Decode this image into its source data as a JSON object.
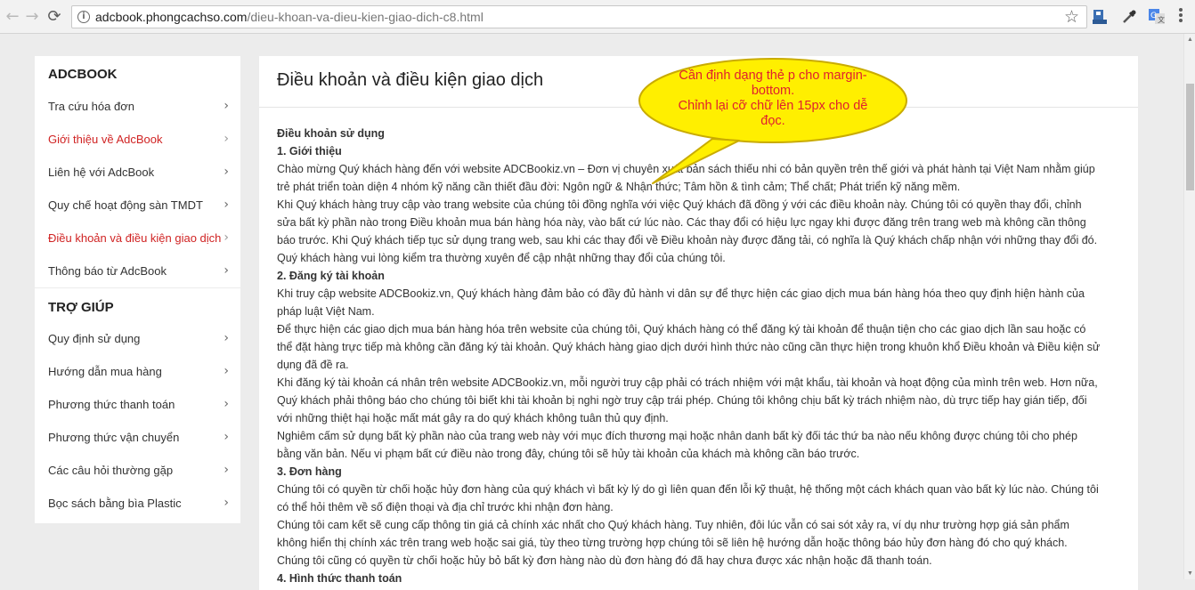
{
  "browser": {
    "back_icon": "←",
    "forward_icon": "→",
    "reload_icon": "⟳",
    "url_domain": "adcbook.phongcachso.com",
    "url_path": "/dieu-khoan-va-dieu-kien-giao-dich-c8.html",
    "star_icon": "☆"
  },
  "sidebar": {
    "section1_title": "ADCBOOK",
    "section1_items": [
      {
        "label": "Tra cứu hóa đơn"
      },
      {
        "label": "Giới thiệu về AdcBook"
      },
      {
        "label": "Liên hệ với AdcBook"
      },
      {
        "label": "Quy chế hoạt động sàn TMDT"
      },
      {
        "label": "Điều khoản và điều kiện giao dịch"
      },
      {
        "label": "Thông báo từ AdcBook"
      }
    ],
    "section2_title": "TRỢ GIÚP",
    "section2_items": [
      {
        "label": "Quy định sử dụng"
      },
      {
        "label": "Hướng dẫn mua hàng"
      },
      {
        "label": "Phương thức thanh toán"
      },
      {
        "label": "Phương thức vận chuyển"
      },
      {
        "label": "Các câu hỏi thường gặp"
      },
      {
        "label": "Bọc sách bằng bìa Plastic"
      }
    ],
    "chevron": "›",
    "highlight_color": "#d02323"
  },
  "main": {
    "title": "Điều khoản và điều kiện giao dịch",
    "lines": [
      {
        "text": "Điều khoản sử dụng",
        "bold": true
      },
      {
        "text": "1. Giới thiệu",
        "bold": true
      },
      {
        "text": "Chào mừng Quý khách hàng đến với website ADCBookiz.vn – Đơn vị chuyên xuất bản sách thiếu nhi có bản quyền trên thế giới và phát hành tại Việt Nam nhằm giúp",
        "bold": false
      },
      {
        "text": "trẻ phát triển toàn diện 4 nhóm kỹ năng cần thiết đầu đời: Ngôn ngữ & Nhận thức; Tâm hồn & tình cảm; Thể chất; Phát triển kỹ năng mềm.",
        "bold": false
      },
      {
        "text": "Khi Quý khách hàng truy cập vào trang website của chúng tôi đồng nghĩa với việc Quý khách đã đồng ý với các điều khoản này. Chúng tôi có quyền thay đổi, chỉnh",
        "bold": false
      },
      {
        "text": "sửa bất kỳ phần nào trong Điều khoản mua bán hàng hóa này, vào bất cứ lúc nào. Các thay đổi có hiệu lực ngay khi được đăng trên trang web mà không cần thông",
        "bold": false
      },
      {
        "text": "báo trước. Khi Quý khách tiếp tục sử dụng trang web, sau khi các thay đổi về Điều khoản này được đăng tải, có nghĩa là Quý khách chấp nhận với những thay đổi đó.",
        "bold": false
      },
      {
        "text": "Quý khách hàng vui lòng kiểm tra thường xuyên để cập nhật những thay đổi của chúng tôi.",
        "bold": false
      },
      {
        "text": "2. Đăng ký tài khoản",
        "bold": true
      },
      {
        "text": "Khi truy cập website ADCBookiz.vn, Quý khách hàng đảm bảo có đầy đủ hành vi dân sự để thực hiện các giao dịch mua bán hàng hóa theo quy định hiện hành của",
        "bold": false
      },
      {
        "text": "pháp luật Việt Nam.",
        "bold": false
      },
      {
        "text": "Để thực hiện các giao dịch mua bán hàng hóa trên website của chúng tôi, Quý khách hàng có thể đăng ký tài khoản để thuận tiện cho các giao dịch lần sau hoặc có",
        "bold": false
      },
      {
        "text": "thể đặt hàng trực tiếp mà không cần đăng ký tài khoản. Quý khách hàng giao dịch dưới hình thức nào cũng cần thực hiện trong khuôn khổ Điều khoản và Điều kiện sử",
        "bold": false
      },
      {
        "text": "dụng đã đề ra.",
        "bold": false
      },
      {
        "text": "Khi đăng ký tài khoản cá nhân trên website ADCBookiz.vn, mỗi người truy cập phải có trách nhiệm với mật khẩu, tài khoản và hoạt động của mình trên web. Hơn nữa,",
        "bold": false
      },
      {
        "text": "Quý khách phải thông báo cho chúng tôi biết khi tài khoản bị nghi ngờ truy cập trái phép. Chúng tôi không chịu bất kỳ trách nhiệm nào, dù trực tiếp hay gián tiếp, đối",
        "bold": false
      },
      {
        "text": "với những thiệt hại hoặc mất mát gây ra do quý khách không tuân thủ quy định.",
        "bold": false
      },
      {
        "text": "Nghiêm cấm sử dụng bất kỳ phần nào của trang web này với mục đích thương mại hoặc nhân danh bất kỳ đối tác thứ ba nào nếu không được chúng tôi cho phép",
        "bold": false
      },
      {
        "text": "bằng văn bản. Nếu vi phạm bất cứ điều nào trong đây, chúng tôi sẽ hủy tài khoản của khách mà không cần báo trước.",
        "bold": false
      },
      {
        "text": "3. Đơn hàng",
        "bold": true
      },
      {
        "text": "Chúng tôi có quyền từ chối hoặc hủy đơn hàng của quý khách vì bất kỳ lý do gì liên quan đến lỗi kỹ thuật, hệ thống một cách khách quan vào bất kỳ lúc nào. Chúng tôi",
        "bold": false
      },
      {
        "text": "có thể hỏi thêm về số điện thoại và địa chỉ trước khi nhận đơn hàng.",
        "bold": false
      },
      {
        "text": "Chúng tôi cam kết sẽ cung cấp thông tin giá cả chính xác nhất cho Quý khách hàng. Tuy nhiên, đôi lúc vẫn có sai sót xảy ra, ví dụ như trường hợp giá sản phẩm",
        "bold": false
      },
      {
        "text": "không hiển thị chính xác trên trang web hoặc sai giá, tùy theo từng trường hợp chúng tôi sẽ liên hệ hướng dẫn hoặc thông báo hủy đơn hàng đó cho quý khách.",
        "bold": false
      },
      {
        "text": "Chúng tôi cũng có quyền từ chối hoặc hủy bỏ bất kỳ đơn hàng nào dù đơn hàng đó đã hay chưa được xác nhận hoặc đã thanh toán.",
        "bold": false
      },
      {
        "text": "4. Hình thức thanh toán",
        "bold": true
      }
    ]
  },
  "callout": {
    "line1": "Cần định dạng thẻ p cho margin-",
    "line2": "bottom.",
    "line3": "Chỉnh lại cỡ chữ lên 15px cho dễ",
    "line4": "đọc.",
    "fill_color": "#ffef00",
    "text_color": "#e0202e"
  }
}
